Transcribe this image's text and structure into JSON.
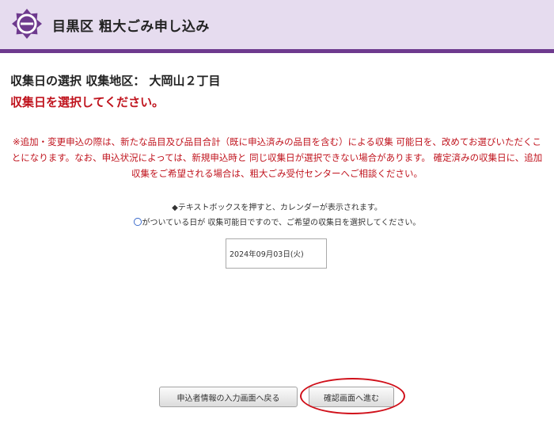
{
  "header": {
    "title": "目黒区 粗大ごみ申し込み",
    "logo_icon": "meguro-ward-emblem",
    "brand_color": "#6e3a8e",
    "band_color": "#e6dcef"
  },
  "main": {
    "heading": "収集日の選択 収集地区： 大岡山２丁目",
    "instruction": "収集日を選択してください。",
    "notice": "※追加・変更申込の際は、新たな品目及び品目合計（既に申込済みの品目を含む）による収集 可能日を、改めてお選びいただくことになります。なお、申込状況によっては、新規申込時と 同じ収集日が選択できない場合があります。 確定済みの収集日に、追加収集をご希望される場合は、粗大ごみ受付センターへご相談ください。",
    "hint_line1": "◆テキストボックスを押すと、カレンダーが表示されます。",
    "hint_circle": "〇",
    "hint_line2": "がついている日が 収集可能日ですので、ご希望の収集日を選択してください。",
    "date_value": "2024年09月03日(火)",
    "accent_red": "#c0141e"
  },
  "buttons": {
    "back_label": "申込者情報の入力画面へ戻る",
    "confirm_label": "確認画面へ進む"
  }
}
